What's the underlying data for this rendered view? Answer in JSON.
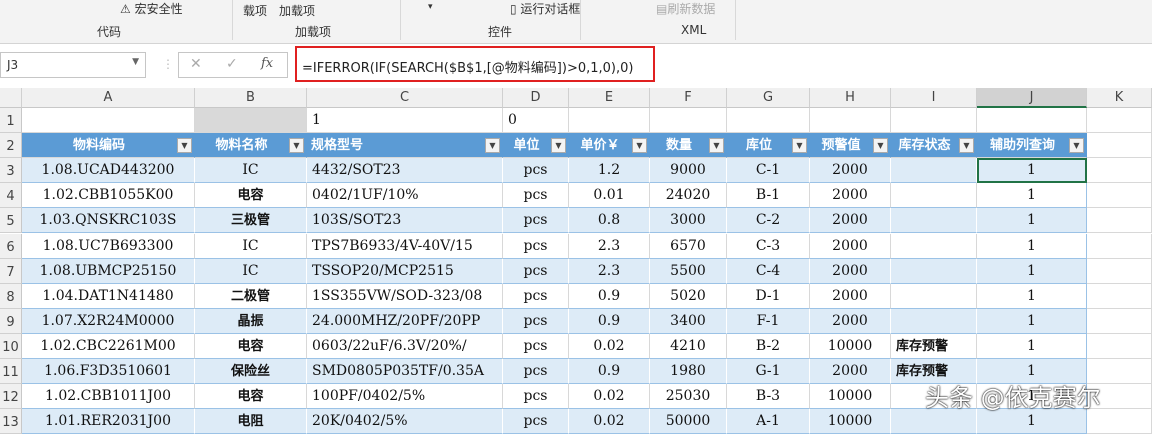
{
  "ribbon": {
    "macro_security": "宏安全性",
    "addins_short": "载项",
    "addins": "加载项",
    "run_dialog": "运行对话框",
    "refresh_data": "刷新数据",
    "groups": [
      "代码",
      "加载项",
      "控件",
      "XML"
    ]
  },
  "formula_bar": {
    "name_box": "J3",
    "cancel": "✕",
    "enter": "✓",
    "fx": "fx",
    "formula": "=IFERROR(IF(SEARCH($B$1,[@物料编码])>0,1,0),0)"
  },
  "columns": [
    "A",
    "B",
    "C",
    "D",
    "E",
    "F",
    "G",
    "H",
    "I",
    "J",
    "K"
  ],
  "row1": {
    "C": "1",
    "D": "0"
  },
  "headers": [
    "物料编码",
    "物料名称",
    "规格型号",
    "单位",
    "单价￥",
    "数量",
    "库位",
    "预警值",
    "库存状态",
    "辅助列查询"
  ],
  "rows": [
    [
      "1.08.UCAD443200",
      "IC",
      "4432/SOT23",
      "pcs",
      "1.2",
      "9000",
      "C-1",
      "2000",
      "",
      "1"
    ],
    [
      "1.02.CBB1055K00",
      "电容",
      "0402/1UF/10%",
      "pcs",
      "0.01",
      "24020",
      "B-1",
      "2000",
      "",
      "1"
    ],
    [
      "1.03.QNSKRC103S",
      "三极管",
      "103S/SOT23",
      "pcs",
      "0.8",
      "3000",
      "C-2",
      "2000",
      "",
      "1"
    ],
    [
      "1.08.UC7B693300",
      "IC",
      "TPS7B6933/4V-40V/15",
      "pcs",
      "2.3",
      "6570",
      "C-3",
      "2000",
      "",
      "1"
    ],
    [
      "1.08.UBMCP25150",
      "IC",
      "TSSOP20/MCP2515",
      "pcs",
      "2.3",
      "5500",
      "C-4",
      "2000",
      "",
      "1"
    ],
    [
      "1.04.DAT1N41480",
      "二极管",
      "1SS355VW/SOD-323/08",
      "pcs",
      "0.9",
      "5020",
      "D-1",
      "2000",
      "",
      "1"
    ],
    [
      "1.07.X2R24M0000",
      "晶振",
      "24.000MHZ/20PF/20PP",
      "pcs",
      "0.9",
      "3400",
      "F-1",
      "2000",
      "",
      "1"
    ],
    [
      "1.02.CBC2261M00",
      "电容",
      "0603/22uF/6.3V/20%/",
      "pcs",
      "0.02",
      "4210",
      "B-2",
      "10000",
      "库存预警",
      "1"
    ],
    [
      "1.06.F3D3510601",
      "保险丝",
      "SMD0805P035TF/0.35A",
      "pcs",
      "0.9",
      "1980",
      "G-1",
      "2000",
      "库存预警",
      "1"
    ],
    [
      "1.02.CBB1011J00",
      "电容",
      "100PF/0402/5%",
      "pcs",
      "0.02",
      "25030",
      "B-3",
      "10000",
      "",
      "1"
    ],
    [
      "1.01.RER2031J00",
      "电阻",
      "20K/0402/5%",
      "pcs",
      "0.02",
      "50000",
      "A-1",
      "10000",
      "",
      "1"
    ]
  ],
  "watermark": "头条 @依克赛尔"
}
